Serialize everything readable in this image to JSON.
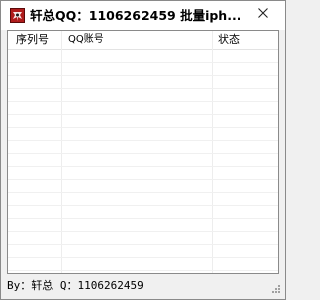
{
  "window": {
    "title": "轩总QQ：1106262459  批量iph..."
  },
  "list": {
    "columns": [
      "序列号",
      "QQ账号",
      "状态"
    ],
    "rows": []
  },
  "status": {
    "text": "By：轩总  Q：1106262459"
  },
  "icons": {
    "app": "app-logo-icon",
    "close": "close-icon",
    "grip": "resize-grip-icon"
  },
  "colors": {
    "title_bg": "#ffffff",
    "window_bg": "#f0f0f0",
    "list_bg": "#ffffff",
    "grid_line": "#f0f0f0"
  }
}
